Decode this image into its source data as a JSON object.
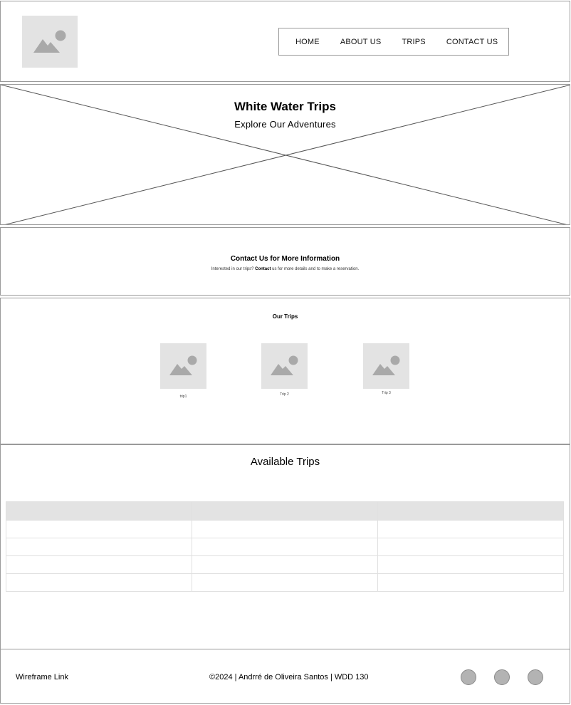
{
  "nav": {
    "items": [
      {
        "label": "HOME"
      },
      {
        "label": "ABOUT US"
      },
      {
        "label": "TRIPS"
      },
      {
        "label": "CONTACT US"
      }
    ]
  },
  "hero": {
    "title": "White Water Trips",
    "subtitle": "Explore Our Adventures"
  },
  "contact": {
    "title": "Contact Us for More Information",
    "text_before": "Interested in our trips?",
    "link": "Contact",
    "text_after": "us for more details and to make a reservation."
  },
  "trips": {
    "title": "Our Trips",
    "items": [
      {
        "label": "trip1"
      },
      {
        "label": "Trip 2"
      },
      {
        "label": "Trip 3"
      }
    ]
  },
  "available": {
    "title": "Available Trips"
  },
  "footer": {
    "left": "Wireframe Link",
    "center": "©2024 | Andrré de Oliveira Santos | WDD 130"
  },
  "colors": {
    "placeholder_bg": "#e3e3e3",
    "placeholder_icon": "#a9a9a9",
    "border": "#9a9a9a",
    "social": "#b3b3b3"
  }
}
